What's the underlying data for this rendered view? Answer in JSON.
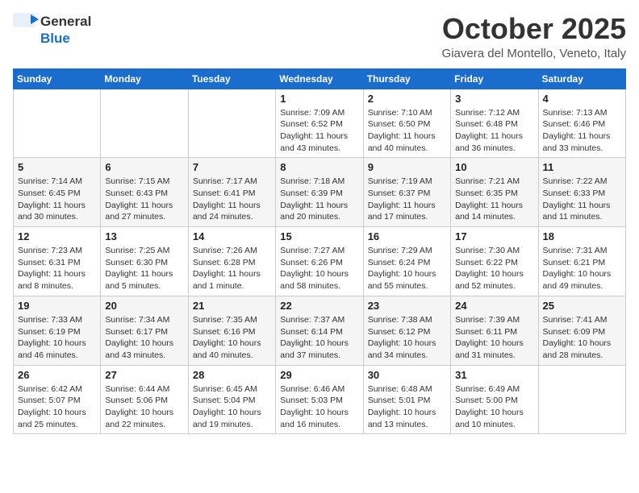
{
  "header": {
    "logo_general": "General",
    "logo_blue": "Blue",
    "month_title": "October 2025",
    "location": "Giavera del Montello, Veneto, Italy"
  },
  "weekdays": [
    "Sunday",
    "Monday",
    "Tuesday",
    "Wednesday",
    "Thursday",
    "Friday",
    "Saturday"
  ],
  "weeks": [
    [
      {
        "day": "",
        "info": ""
      },
      {
        "day": "",
        "info": ""
      },
      {
        "day": "",
        "info": ""
      },
      {
        "day": "1",
        "info": "Sunrise: 7:09 AM\nSunset: 6:52 PM\nDaylight: 11 hours\nand 43 minutes."
      },
      {
        "day": "2",
        "info": "Sunrise: 7:10 AM\nSunset: 6:50 PM\nDaylight: 11 hours\nand 40 minutes."
      },
      {
        "day": "3",
        "info": "Sunrise: 7:12 AM\nSunset: 6:48 PM\nDaylight: 11 hours\nand 36 minutes."
      },
      {
        "day": "4",
        "info": "Sunrise: 7:13 AM\nSunset: 6:46 PM\nDaylight: 11 hours\nand 33 minutes."
      }
    ],
    [
      {
        "day": "5",
        "info": "Sunrise: 7:14 AM\nSunset: 6:45 PM\nDaylight: 11 hours\nand 30 minutes."
      },
      {
        "day": "6",
        "info": "Sunrise: 7:15 AM\nSunset: 6:43 PM\nDaylight: 11 hours\nand 27 minutes."
      },
      {
        "day": "7",
        "info": "Sunrise: 7:17 AM\nSunset: 6:41 PM\nDaylight: 11 hours\nand 24 minutes."
      },
      {
        "day": "8",
        "info": "Sunrise: 7:18 AM\nSunset: 6:39 PM\nDaylight: 11 hours\nand 20 minutes."
      },
      {
        "day": "9",
        "info": "Sunrise: 7:19 AM\nSunset: 6:37 PM\nDaylight: 11 hours\nand 17 minutes."
      },
      {
        "day": "10",
        "info": "Sunrise: 7:21 AM\nSunset: 6:35 PM\nDaylight: 11 hours\nand 14 minutes."
      },
      {
        "day": "11",
        "info": "Sunrise: 7:22 AM\nSunset: 6:33 PM\nDaylight: 11 hours\nand 11 minutes."
      }
    ],
    [
      {
        "day": "12",
        "info": "Sunrise: 7:23 AM\nSunset: 6:31 PM\nDaylight: 11 hours\nand 8 minutes."
      },
      {
        "day": "13",
        "info": "Sunrise: 7:25 AM\nSunset: 6:30 PM\nDaylight: 11 hours\nand 5 minutes."
      },
      {
        "day": "14",
        "info": "Sunrise: 7:26 AM\nSunset: 6:28 PM\nDaylight: 11 hours\nand 1 minute."
      },
      {
        "day": "15",
        "info": "Sunrise: 7:27 AM\nSunset: 6:26 PM\nDaylight: 10 hours\nand 58 minutes."
      },
      {
        "day": "16",
        "info": "Sunrise: 7:29 AM\nSunset: 6:24 PM\nDaylight: 10 hours\nand 55 minutes."
      },
      {
        "day": "17",
        "info": "Sunrise: 7:30 AM\nSunset: 6:22 PM\nDaylight: 10 hours\nand 52 minutes."
      },
      {
        "day": "18",
        "info": "Sunrise: 7:31 AM\nSunset: 6:21 PM\nDaylight: 10 hours\nand 49 minutes."
      }
    ],
    [
      {
        "day": "19",
        "info": "Sunrise: 7:33 AM\nSunset: 6:19 PM\nDaylight: 10 hours\nand 46 minutes."
      },
      {
        "day": "20",
        "info": "Sunrise: 7:34 AM\nSunset: 6:17 PM\nDaylight: 10 hours\nand 43 minutes."
      },
      {
        "day": "21",
        "info": "Sunrise: 7:35 AM\nSunset: 6:16 PM\nDaylight: 10 hours\nand 40 minutes."
      },
      {
        "day": "22",
        "info": "Sunrise: 7:37 AM\nSunset: 6:14 PM\nDaylight: 10 hours\nand 37 minutes."
      },
      {
        "day": "23",
        "info": "Sunrise: 7:38 AM\nSunset: 6:12 PM\nDaylight: 10 hours\nand 34 minutes."
      },
      {
        "day": "24",
        "info": "Sunrise: 7:39 AM\nSunset: 6:11 PM\nDaylight: 10 hours\nand 31 minutes."
      },
      {
        "day": "25",
        "info": "Sunrise: 7:41 AM\nSunset: 6:09 PM\nDaylight: 10 hours\nand 28 minutes."
      }
    ],
    [
      {
        "day": "26",
        "info": "Sunrise: 6:42 AM\nSunset: 5:07 PM\nDaylight: 10 hours\nand 25 minutes."
      },
      {
        "day": "27",
        "info": "Sunrise: 6:44 AM\nSunset: 5:06 PM\nDaylight: 10 hours\nand 22 minutes."
      },
      {
        "day": "28",
        "info": "Sunrise: 6:45 AM\nSunset: 5:04 PM\nDaylight: 10 hours\nand 19 minutes."
      },
      {
        "day": "29",
        "info": "Sunrise: 6:46 AM\nSunset: 5:03 PM\nDaylight: 10 hours\nand 16 minutes."
      },
      {
        "day": "30",
        "info": "Sunrise: 6:48 AM\nSunset: 5:01 PM\nDaylight: 10 hours\nand 13 minutes."
      },
      {
        "day": "31",
        "info": "Sunrise: 6:49 AM\nSunset: 5:00 PM\nDaylight: 10 hours\nand 10 minutes."
      },
      {
        "day": "",
        "info": ""
      }
    ]
  ]
}
